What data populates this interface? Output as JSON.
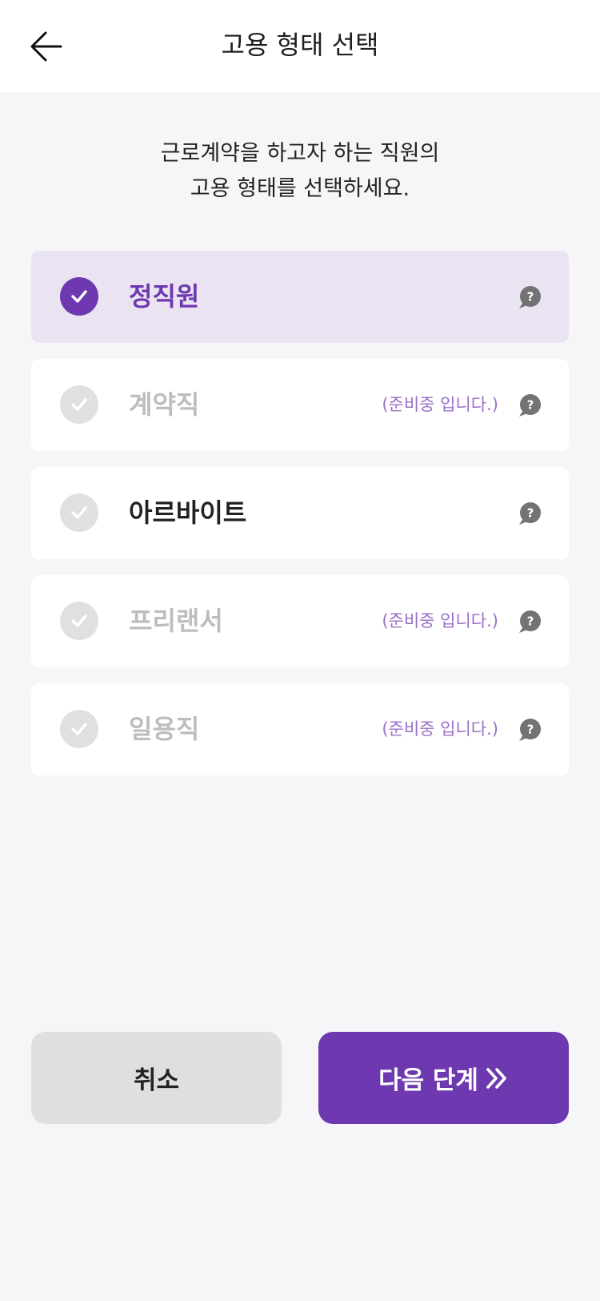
{
  "header": {
    "title": "고용 형태 선택",
    "back_icon": "arrow-left-icon"
  },
  "instruction": {
    "line1": "근로계약을 하고자 하는 직원의",
    "line2": "고용 형태를 선택하세요."
  },
  "options": [
    {
      "label": "정직원",
      "note": "",
      "state": "selected"
    },
    {
      "label": "계약직",
      "note": "(준비중 입니다.)",
      "state": "disabled"
    },
    {
      "label": "아르바이트",
      "note": "",
      "state": "available"
    },
    {
      "label": "프리랜서",
      "note": "(준비중 입니다.)",
      "state": "disabled"
    },
    {
      "label": "일용직",
      "note": "(준비중 입니다.)",
      "state": "disabled"
    }
  ],
  "buttons": {
    "cancel": "취소",
    "next": "다음 단계"
  },
  "colors": {
    "accent": "#6e38b0",
    "selected_bg": "#eae4f2",
    "note": "#9a6fc9",
    "disabled_check": "#e0e0e0",
    "background": "#f6f6f8"
  }
}
